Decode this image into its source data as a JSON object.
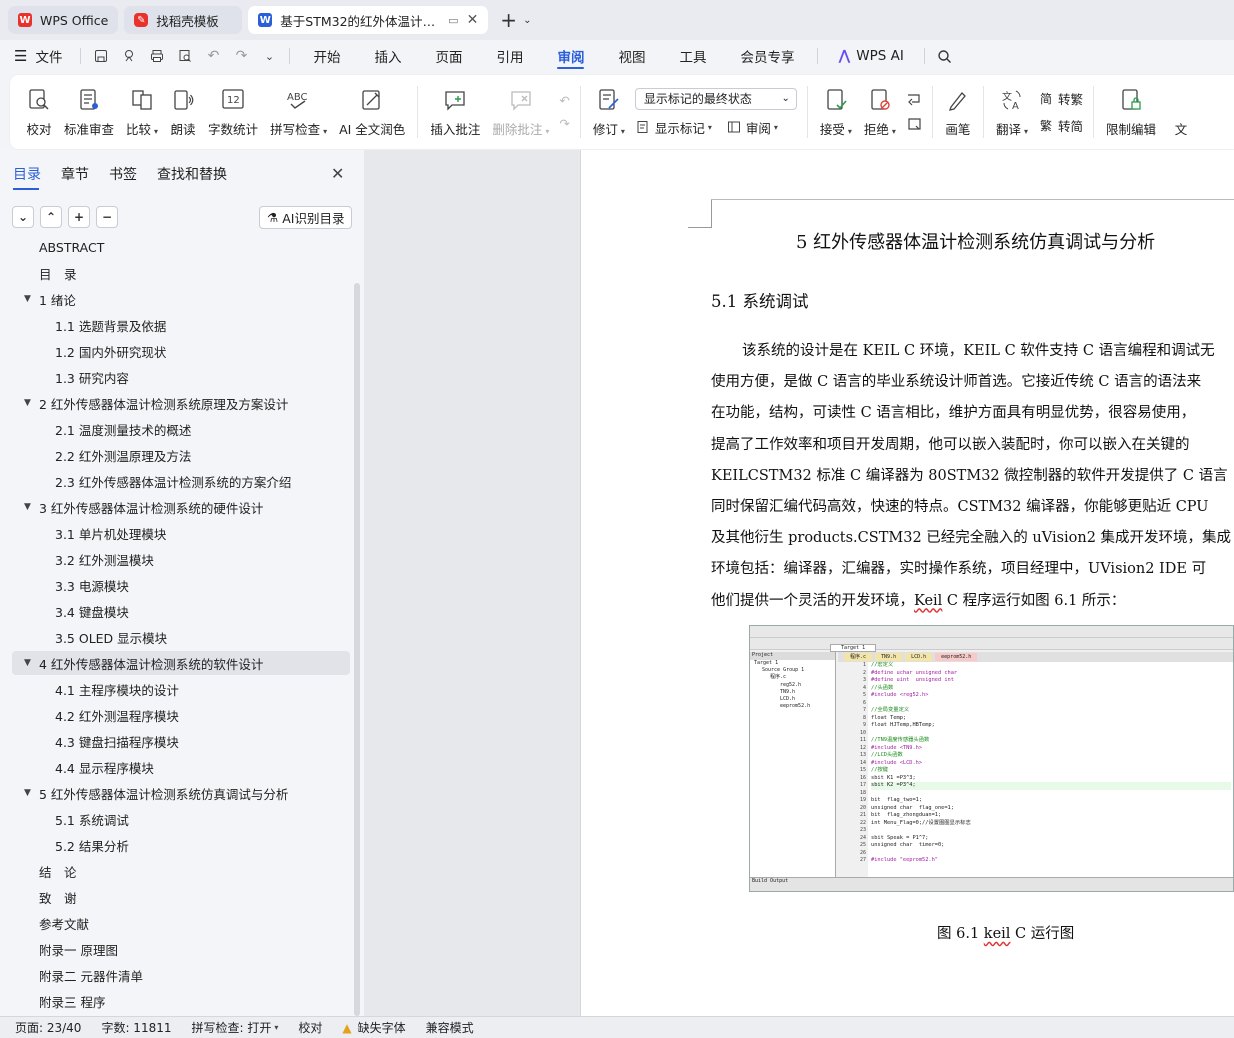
{
  "tabs": [
    {
      "label": "WPS Office",
      "icon": "wps-logo-icon",
      "color": "#e8322b"
    },
    {
      "label": "找稻壳模板",
      "icon": "docer-logo-icon",
      "color": "#e8322b"
    },
    {
      "label": "基于STM32的红外体温计检测",
      "icon": "word-doc-icon",
      "color": "#2b5fd9"
    }
  ],
  "menubar": {
    "file": "文件",
    "items": [
      "开始",
      "插入",
      "页面",
      "引用",
      "审阅",
      "视图",
      "工具",
      "会员专享"
    ],
    "active": "审阅",
    "wps_ai": "WPS AI"
  },
  "ribbon": {
    "proofread": "校对",
    "standard_review": "标准审查",
    "compare": "比较",
    "read_aloud": "朗读",
    "word_count": "字数统计",
    "spell_check": "拼写检查",
    "ai_polish": "AI 全文润色",
    "insert_comment": "插入批注",
    "delete_comment": "删除批注",
    "revise": "修订",
    "display_select": "显示标记的最终状态",
    "show_markup": "显示标记",
    "review": "审阅",
    "accept": "接受",
    "reject": "拒绝",
    "pen": "画笔",
    "translate": "翻译",
    "to_traditional": "转繁",
    "to_simplified": "转简",
    "restrict_edit": "限制编辑",
    "cut_label": "文"
  },
  "panel": {
    "tabs": [
      "目录",
      "章节",
      "书签",
      "查找和替换"
    ],
    "ai_toc": "AI识别目录",
    "toc": [
      {
        "text": "ABSTRACT",
        "level": 0
      },
      {
        "text": "目　录",
        "level": 0
      },
      {
        "text": "1 绪论",
        "level": 0,
        "expand": true
      },
      {
        "text": "1.1 选题背景及依据",
        "level": 1
      },
      {
        "text": "1.2 国内外研究现状",
        "level": 1
      },
      {
        "text": "1.3 研究内容",
        "level": 1
      },
      {
        "text": "2  红外传感器体温计检测系统原理及方案设计",
        "level": 0,
        "expand": true
      },
      {
        "text": "2.1 温度测量技术的概述",
        "level": 1
      },
      {
        "text": "2.2  红外测温原理及方法",
        "level": 1
      },
      {
        "text": "2.3  红外传感器体温计检测系统的方案介绍",
        "level": 1
      },
      {
        "text": "3  红外传感器体温计检测系统的硬件设计",
        "level": 0,
        "expand": true
      },
      {
        "text": "3.1  单片机处理模块",
        "level": 1
      },
      {
        "text": "3.2  红外测温模块",
        "level": 1
      },
      {
        "text": "3.3  电源模块",
        "level": 1
      },
      {
        "text": "3.4  键盘模块",
        "level": 1
      },
      {
        "text": "3.5 OLED 显示模块",
        "level": 1
      },
      {
        "text": "4  红外传感器体温计检测系统的软件设计",
        "level": 0,
        "expand": true,
        "selected": true
      },
      {
        "text": "4.1  主程序模块的设计",
        "level": 1
      },
      {
        "text": "4.2  红外测温程序模块",
        "level": 1
      },
      {
        "text": "4.3  键盘扫描程序模块",
        "level": 1
      },
      {
        "text": "4.4  显示程序模块",
        "level": 1
      },
      {
        "text": "5  红外传感器体温计检测系统仿真调试与分析",
        "level": 0,
        "expand": true
      },
      {
        "text": "5.1  系统调试",
        "level": 1
      },
      {
        "text": "5.2  结果分析",
        "level": 1
      },
      {
        "text": "结　论",
        "level": 0
      },
      {
        "text": "致　谢",
        "level": 0
      },
      {
        "text": "参考文献",
        "level": 0
      },
      {
        "text": "附录一  原理图",
        "level": 0
      },
      {
        "text": "附录二  元器件清单",
        "level": 0
      },
      {
        "text": "附录三  程序",
        "level": 0
      }
    ]
  },
  "doc": {
    "h1": "5  红外传感器体温计检测系统仿真调试与分析",
    "h2": "5.1 系统调试",
    "lines": [
      "该系统的设计是在 KEIL C 环境，KEIL C 软件支持 C 语言编程和调试无",
      "使用方便，是做 C 语言的毕业系统设计师首选。它接近传统 C 语言的语法来",
      "在功能，结构，可读性 C 语言相比，维护方面具有明显优势，很容易使用，",
      "提高了工作效率和项目开发周期，他可以嵌入装配时，你可以嵌入在关键的",
      "KEILCSTM32 标准 C 编译器为 80STM32 微控制器的软件开发提供了 C 语言",
      "同时保留汇编代码高效，快速的特点。CSTM32 编译器，你能够更贴近 CPU",
      "及其他衍生 products.CSTM32 已经完全融入的 uVision2 集成开发环境，集成",
      "环境包括：编译器，汇编器，实时操作系统，项目经理中，UVision2 IDE 可",
      "他们提供一个灵活的开发环境，"
    ],
    "last_line_squig": "Keil",
    "last_line_tail": " C 程序运行如图 6.1 所示：",
    "figure": {
      "target_label": "Target 1",
      "project_header": "Project",
      "tree": [
        "Target 1",
        "Source Group 1",
        "程序.c",
        "reg52.h",
        "TN9.h",
        "LCD.h",
        "eeprom52.h"
      ],
      "editor_tabs": [
        "程序.c",
        "TN9.h",
        "LCD.h",
        "eeprom52.h"
      ],
      "code": [
        "//宏定义",
        "#define uchar unsigned char",
        "#define uint  unsigned int",
        "//头函数",
        "#include <reg52.h>",
        "",
        "//全局变量定义",
        "float Temp;",
        "float HJTemp,HBTemp;",
        "",
        "//TN9温度传感器头函数",
        "#include <TN9.h>",
        "//LCD头函数",
        "#include <LCD.h>",
        "//按键",
        "sbit K1 =P3^3;",
        "sbit K2 =P3^4;",
        "",
        "bit  flag_two=1;",
        "unsigned char  flag_one=1;",
        "bit  flag_zhongduan=1;",
        "int Menu_Flag=0;//设置图图显示标志",
        "",
        "sbit Speak = P1^7;",
        "unsigned char  timer=0;",
        "",
        "#include \"eeprom52.h\""
      ],
      "build_output": "Build Output"
    },
    "caption_prefix": "图 6.1   ",
    "caption_squig": "keil",
    "caption_tail": " C 运行图"
  },
  "status": {
    "page": "页面: 23/40",
    "words": "字数: 11811",
    "spell": "拼写检查: 打开",
    "proof": "校对",
    "missing_font": "缺失字体",
    "compat": "兼容模式"
  },
  "colors": {
    "accent": "#2b5fd9",
    "wps_red": "#e8322b",
    "ai_purple": "#6a4cf6"
  }
}
